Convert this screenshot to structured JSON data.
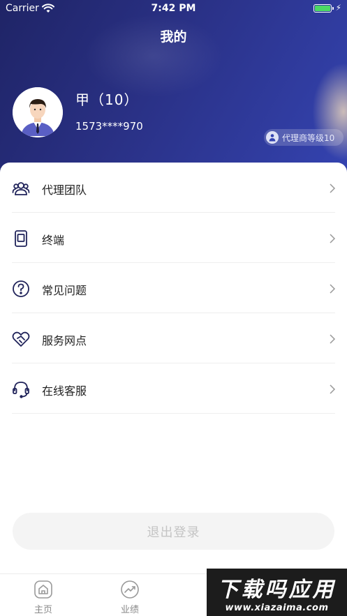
{
  "status_bar": {
    "carrier": "Carrier",
    "time": "7:42 PM"
  },
  "header": {
    "title": "我的"
  },
  "user": {
    "name": "甲（10）",
    "phone": "1573****970",
    "level_badge": "代理商等级10"
  },
  "menu": [
    {
      "label": "代理团队",
      "icon": "team-icon"
    },
    {
      "label": "终端",
      "icon": "terminal-icon"
    },
    {
      "label": "常见问题",
      "icon": "question-icon"
    },
    {
      "label": "服务网点",
      "icon": "handshake-heart-icon"
    },
    {
      "label": "在线客服",
      "icon": "headset-icon"
    }
  ],
  "logout_label": "退出登录",
  "tabbar": [
    {
      "label": "主页",
      "icon": "home-icon"
    },
    {
      "label": "业绩",
      "icon": "performance-icon"
    }
  ],
  "watermark": {
    "line1": "下载吗应用",
    "line2": "www.xiazaima.com"
  },
  "colors": {
    "header_start": "#1f2466",
    "header_end": "#3443b0",
    "icon": "#1f2259",
    "battery": "#4cd964"
  }
}
